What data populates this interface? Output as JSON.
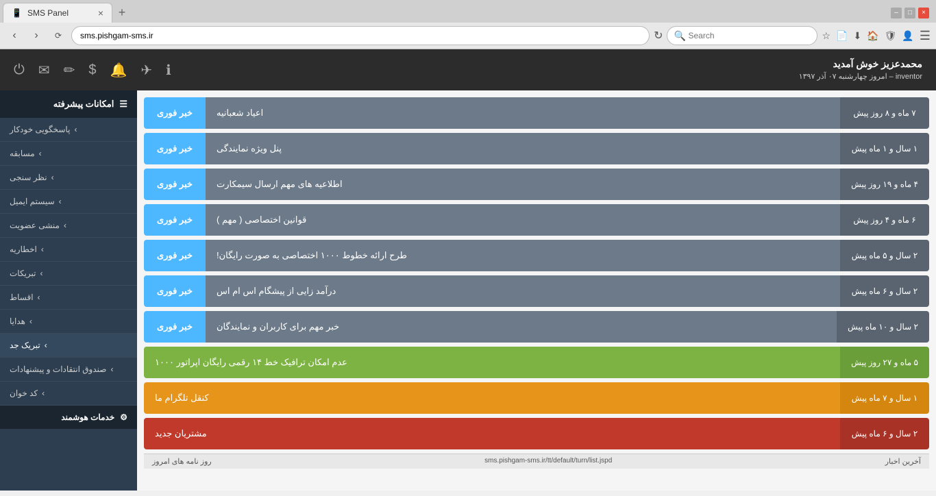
{
  "browser": {
    "tab_title": "SMS Panel",
    "tab_close": "×",
    "tab_add": "+",
    "address": "sms.pishgam-sms.ir",
    "search_placeholder": "Search",
    "win_min": "–",
    "win_max": "□",
    "win_close": "×"
  },
  "topnav": {
    "user_name": "محمدعزیز خوش آمدید",
    "user_subtitle": "inventor – امروز چهارشنبه ۰۷ آذر ۱۳۹۷",
    "icons": [
      "⏻",
      "✉",
      "✏",
      "$",
      "🔔",
      "✈",
      "ℹ"
    ]
  },
  "sidebar": {
    "header_label": "امکانات پیشرفته",
    "items": [
      {
        "label": "پاسخگویی خودکار"
      },
      {
        "label": "مسابقه"
      },
      {
        "label": "نظر سنجی"
      },
      {
        "label": "سیستم ایمیل"
      },
      {
        "label": "منشی عضویت"
      },
      {
        "label": "اخطاریه"
      },
      {
        "label": "تبریکات"
      },
      {
        "label": "اقساط"
      },
      {
        "label": "هدایا"
      },
      {
        "label": "تبریک جد"
      },
      {
        "label": "صندوق انتقادات و پیشنهادات"
      },
      {
        "label": "کد خوان"
      }
    ],
    "footer_header": "خدمات هوشمند"
  },
  "news": [
    {
      "badge": "خبر فوری",
      "title": "اعیاد شعبانیه",
      "date": "۷ ماه و ۸ روز پیش",
      "type": "blue"
    },
    {
      "badge": "خبر فوری",
      "title": "پنل ویژه نمایندگی",
      "date": "۱ سال و ۱ ماه پیش",
      "type": "blue"
    },
    {
      "badge": "خبر فوری",
      "title": "اطلاعیه های مهم ارسال سیمکارت",
      "date": "۴ ماه و ۱۹ روز پیش",
      "type": "blue"
    },
    {
      "badge": "خبر فوری",
      "title": "قوانین اختصاصی ( مهم )",
      "date": "۶ ماه و ۴ روز پیش",
      "type": "blue"
    },
    {
      "badge": "خبر فوری",
      "title": "طرح ارائه خطوط ۱۰۰۰ اختصاصی به صورت رایگان!",
      "date": "۲ سال و ۵ ماه پیش",
      "type": "blue"
    },
    {
      "badge": "خبر فوری",
      "title": "درآمد زایی از پیشگام اس ام اس",
      "date": "۲ سال و ۶ ماه پیش",
      "type": "blue"
    },
    {
      "badge": "خبر فوری",
      "title": "خبر مهم برای کاربران و نمایندگان",
      "date": "۲ سال و ۱۰ ماه پیش",
      "type": "blue"
    },
    {
      "badge": "عدم امکان ترافیک خط ۱۴ رقمی رایگان اپراتور ۱۰۰۰",
      "title": "",
      "date": "۵ ماه و ۲۷ روز پیش",
      "type": "green"
    },
    {
      "badge": "کنقل تلگرام ما",
      "title": "",
      "date": "۱ سال و ۷ ماه پیش",
      "type": "yellow"
    },
    {
      "badge": "مشتریان جدید",
      "title": "",
      "date": "۲ سال و ۶ ماه پیش",
      "type": "red"
    }
  ],
  "footer": {
    "left": "آخرین اخبار",
    "right": "روز نامه های امروز",
    "url": "sms.pishgam-sms.ir/tt/default/turn/list.jspd"
  }
}
